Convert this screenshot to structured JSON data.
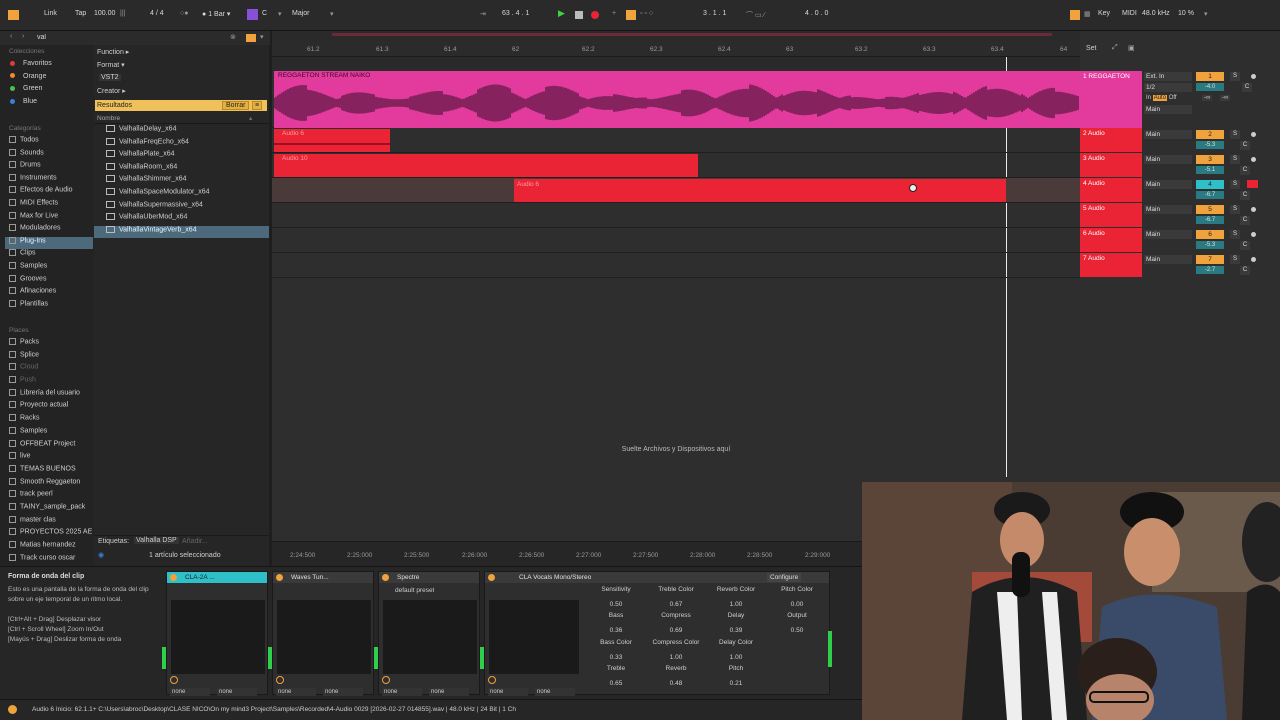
{
  "toolbar": {
    "link": "Link",
    "tap": "Tap",
    "tempo": "100.00",
    "signature": "4 / 4",
    "quantize": "1 Bar",
    "key_root": "C",
    "scale": "Major",
    "position": "63 .   4 .   1",
    "loop_start": "3 .   1 .   1",
    "loop_length": "4 .   0 .   0",
    "key": "Key",
    "midi": "MIDI",
    "sample_rate": "48.0 kHz",
    "cpu": "10 %"
  },
  "browser": {
    "search": "val",
    "collections_title": "Colecciones",
    "collections": [
      {
        "label": "Favoritos",
        "color": "#e23b3b"
      },
      {
        "label": "Orange",
        "color": "#f08a2c"
      },
      {
        "label": "Green",
        "color": "#4cc04c"
      },
      {
        "label": "Blue",
        "color": "#3a7ee0"
      }
    ],
    "categories_title": "Categorías",
    "categories": [
      "Todos",
      "Sounds",
      "Drums",
      "Instruments",
      "Efectos de Audio",
      "MIDI Effects",
      "Max for Live",
      "Moduladores",
      "Plug-Ins",
      "Clips",
      "Samples",
      "Grooves",
      "Afinaciones",
      "Plantillas"
    ],
    "places_title": "Places",
    "places": [
      "Packs",
      "Splice",
      "Cloud",
      "Push",
      "Librería del usuario",
      "Proyecto actual",
      "Racks",
      "Samples",
      "OFFBEAT Project",
      "live",
      "TEMAS BUENOS",
      "Smooth Reggaeton",
      "track peerl",
      "TAINY_sample_pack",
      "master clas",
      "PROYECTOS 2025 AE",
      "Matias hernandez",
      "Track curso oscar"
    ],
    "filters": [
      "Function ▸",
      "Format ▾",
      "VST2",
      "Creator ▸"
    ],
    "results_label": "Resultados",
    "clear_label": "Borrar",
    "name_header": "Nombre",
    "results": [
      "ValhallaDelay_x64",
      "ValhallaFreqEcho_x64",
      "ValhallaPlate_x64",
      "ValhallaRoom_x64",
      "ValhallaShimmer_x64",
      "ValhallaSpaceModulator_x64",
      "ValhallaSupermassive_x64",
      "ValhallaUberMod_x64",
      "ValhallaVintageVerb_x64"
    ],
    "tags_label": "Etiquetas:",
    "tag_value": "Valhalla DSP",
    "tag_add": "Añadir...",
    "selected_count": "1 artículo seleccionado"
  },
  "ruler": {
    "bars": [
      "61.2",
      "61.3",
      "61.4",
      "62",
      "62.2",
      "62.3",
      "62.4",
      "63",
      "63.2",
      "63.3",
      "63.4",
      "64"
    ],
    "times": [
      "2:24:500",
      "2:25:000",
      "2:25:500",
      "2:26:000",
      "2:26:500",
      "2:27:000",
      "2:27:500",
      "2:28:000",
      "2:28:500",
      "2:29:000"
    ],
    "set_label": "Set"
  },
  "tracks": [
    {
      "name": "1 REGGAETON",
      "clip": "REGGAETON STREAM NAIKO",
      "input": "Ext. In",
      "channel": "1/2",
      "num": "1",
      "vol": "-4.0",
      "pan": "C",
      "output": "Main"
    },
    {
      "name": "2 Audio",
      "clip": "Audio 6",
      "input": "Main",
      "num": "2",
      "vol": "-5.3",
      "pan": "C"
    },
    {
      "name": "3 Audio",
      "clip": "Audio 10",
      "input": "Main",
      "num": "3",
      "vol": "-5.1",
      "pan": "C"
    },
    {
      "name": "4 Audio",
      "clip": "Audio 6",
      "input": "Main",
      "num": "4",
      "vol": "-6.7",
      "pan": "C"
    },
    {
      "name": "5 Audio",
      "clip": "",
      "input": "Main",
      "num": "5",
      "vol": "-6.7",
      "pan": "C"
    },
    {
      "name": "6 Audio",
      "clip": "",
      "input": "Main",
      "num": "6",
      "vol": "-5.3",
      "pan": "C"
    },
    {
      "name": "7 Audio",
      "clip": "",
      "input": "Main",
      "num": "7",
      "vol": "-2.7",
      "pan": "C"
    }
  ],
  "monitor": {
    "in": "In",
    "auto": "Auto",
    "off": "Off",
    "inf1": "-∞",
    "inf2": "-∞"
  },
  "drop_text": "Suelte Archivos y Dispositivos aquí",
  "info": {
    "title": "Forma de onda del clip",
    "body": "Esto es una pantalla de la forma de onda del clip sobre un eje temporal de un ritmo local.",
    "hint1": "[Ctrl+Alt + Drag] Desplazar visor",
    "hint2": "[Ctrl + Scroll Wheel] Zoom In/Out",
    "hint3": "[Mayús + Drag] Deslizar forma de onda"
  },
  "devices": [
    {
      "name": "CLA-2A ...",
      "preset": ""
    },
    {
      "name": "Waves Tun...",
      "preset": ""
    },
    {
      "name": "Spectre",
      "preset": "default preset"
    },
    {
      "name": "CLA Vocals Mono/Stereo",
      "preset": ""
    }
  ],
  "device_none": "none",
  "configure": "Configure",
  "params": [
    {
      "label": "Sensitivity",
      "value": "0.50"
    },
    {
      "label": "Treble Color",
      "value": "0.67"
    },
    {
      "label": "Reverb Color",
      "value": "1.00"
    },
    {
      "label": "Pitch Color",
      "value": "0.00"
    },
    {
      "label": "Bass",
      "value": "0.36"
    },
    {
      "label": "Compress",
      "value": "0.69"
    },
    {
      "label": "Delay",
      "value": "0.39"
    },
    {
      "label": "Output",
      "value": "0.50"
    },
    {
      "label": "Bass Color",
      "value": "0.33"
    },
    {
      "label": "Compress Color",
      "value": "1.00"
    },
    {
      "label": "Delay Color",
      "value": "1.00"
    },
    {
      "label": "Treble",
      "value": "0.65"
    },
    {
      "label": "Reverb",
      "value": "0.48"
    },
    {
      "label": "Pitch",
      "value": "0.21"
    }
  ],
  "status": "Audio 6  Inicio: 62.1.1+  C:\\Users\\abroc\\Desktop\\CLASE NICO\\On my mind3 Project\\Samples\\Recorded\\4-Audio 0029 [2026-02-27 014855].wav | 48.0 kHz | 24 Bit | 1 Ch",
  "colors": {
    "pink": "#e23a9d",
    "red": "#ea2435",
    "orange": "#f0a23c",
    "teal": "#2fbfc9",
    "results": "#f0c15a"
  }
}
